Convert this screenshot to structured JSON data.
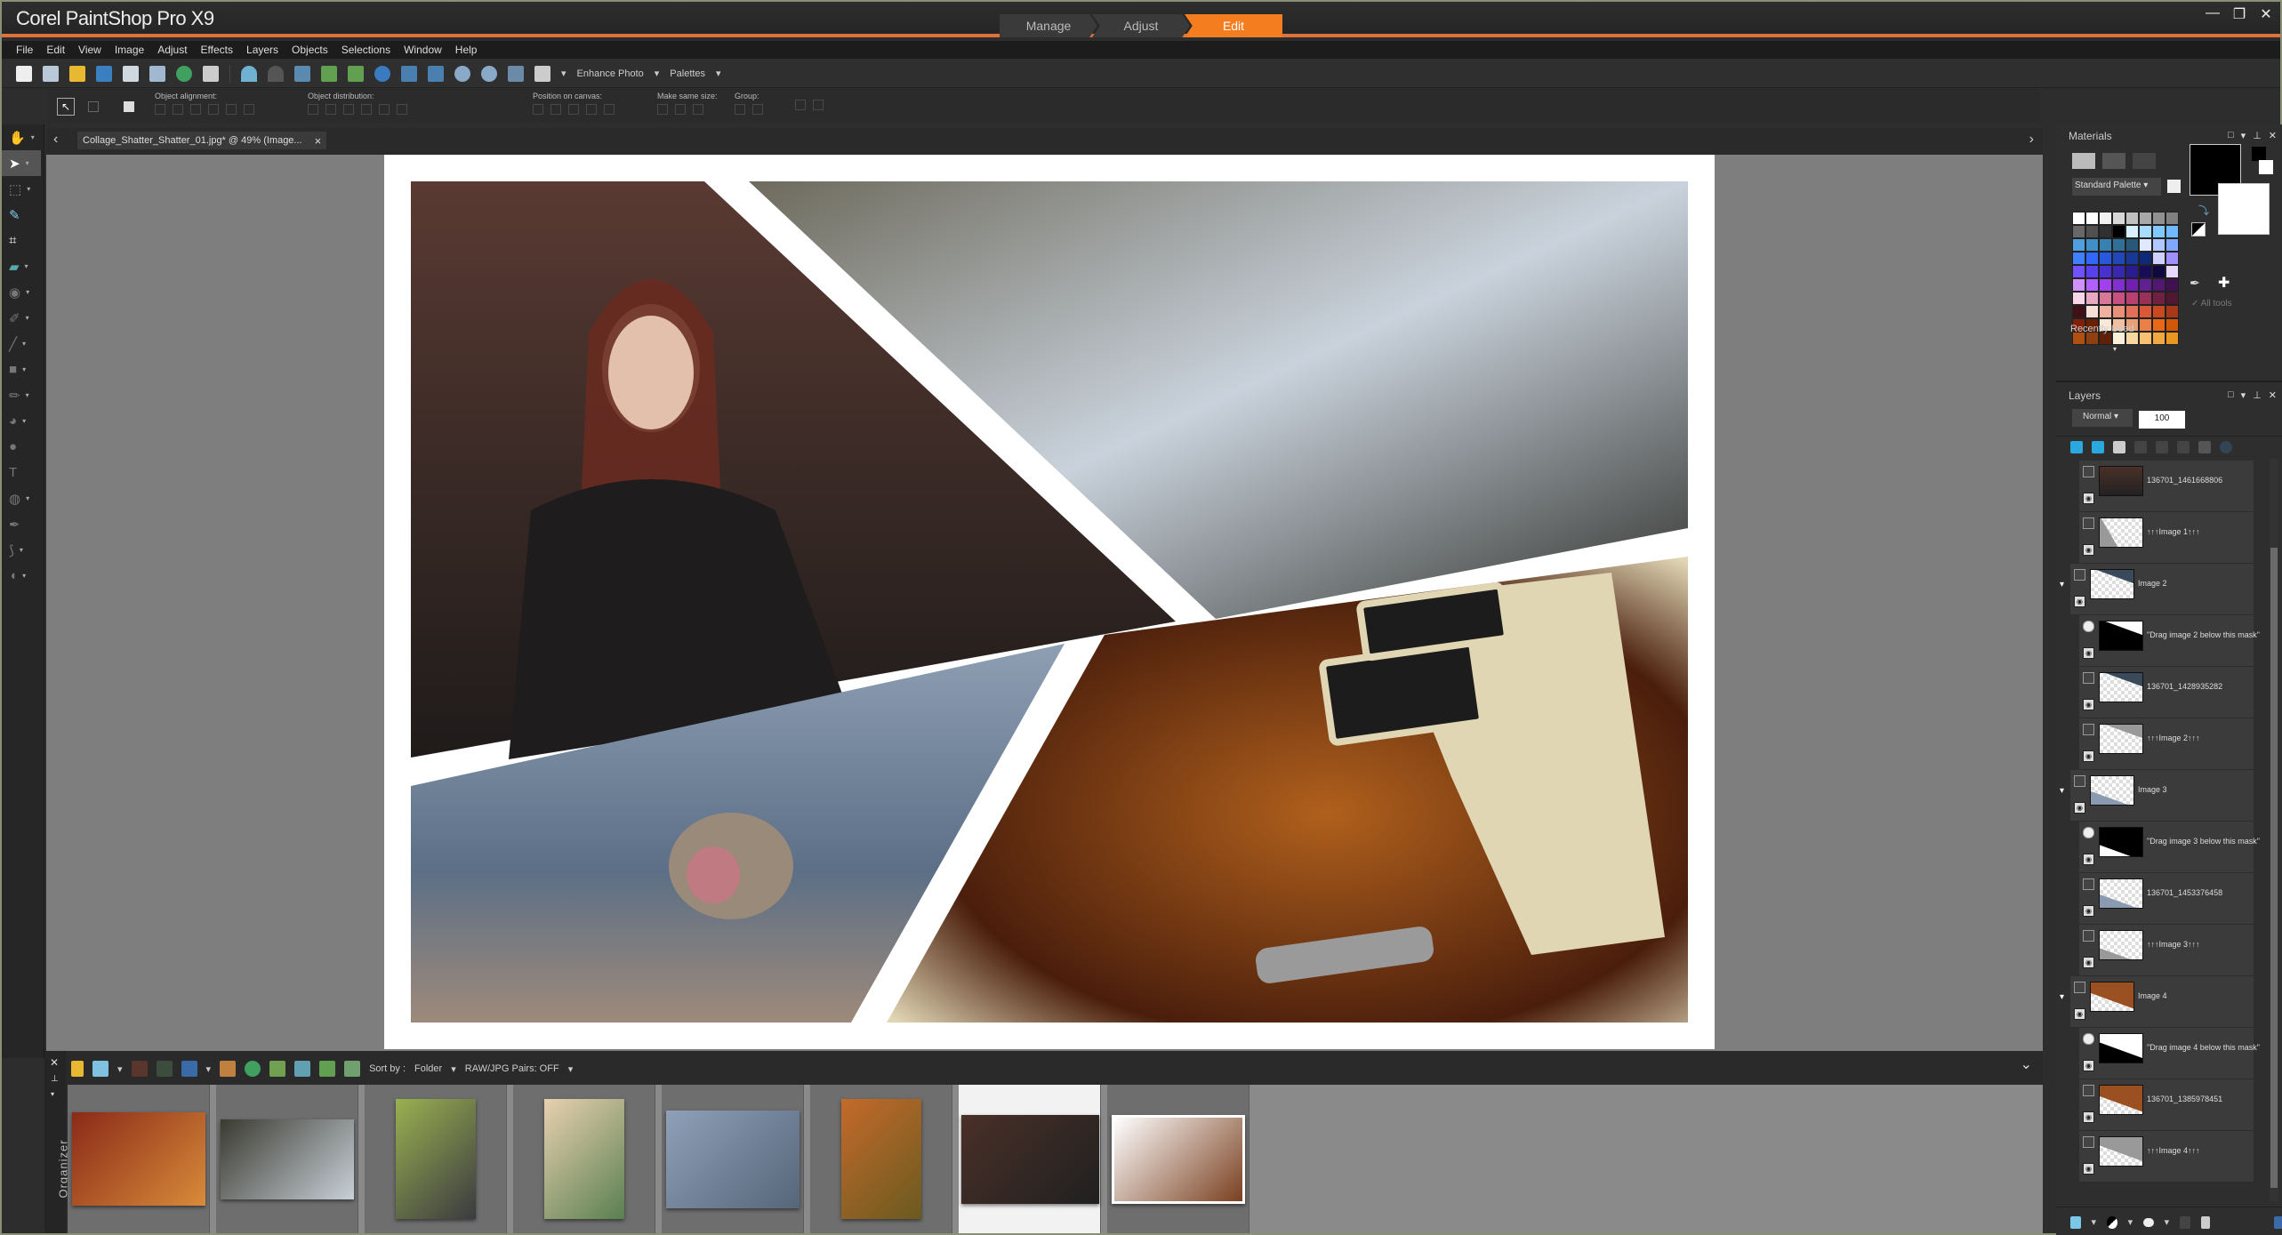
{
  "app": {
    "title": "Corel PaintShop Pro X9"
  },
  "workspace_tabs": [
    {
      "label": "Manage",
      "active": false
    },
    {
      "label": "Adjust",
      "active": false
    },
    {
      "label": "Edit",
      "active": true
    }
  ],
  "window_controls": {
    "minimize": "—",
    "restore": "❐",
    "close": "✕"
  },
  "menu": [
    "File",
    "Edit",
    "View",
    "Image",
    "Adjust",
    "Effects",
    "Layers",
    "Objects",
    "Selections",
    "Window",
    "Help"
  ],
  "toolbar": {
    "enhance_photo_label": "Enhance Photo",
    "palettes_label": "Palettes",
    "icons": [
      "new-icon",
      "new-from-template-icon",
      "open-icon",
      "scan-icon",
      "save-icon",
      "save-as-icon",
      "share-icon",
      "print-icon",
      "undo-icon",
      "redo-icon",
      "resize-icon",
      "rotate-left-icon",
      "rotate-right-icon",
      "info-icon",
      "actual-size-icon",
      "fit-window-icon",
      "zoom-out-icon",
      "zoom-in-icon",
      "zoom-settings-icon",
      "paste-icon"
    ]
  },
  "tool_options": {
    "object_alignment_label": "Object alignment:",
    "object_distribution_label": "Object distribution:",
    "position_on_canvas_label": "Position on canvas:",
    "make_same_size_label": "Make same size:",
    "group_label": "Group:"
  },
  "tools": [
    {
      "name": "pan-tool",
      "glyph": "✋",
      "selected": false,
      "has_menu": true
    },
    {
      "name": "pick-tool",
      "glyph": "➤",
      "selected": true,
      "has_menu": true
    },
    {
      "name": "selection-tool",
      "glyph": "⬚",
      "selected": false,
      "has_menu": true
    },
    {
      "name": "dropper-tool",
      "glyph": "✎",
      "selected": false,
      "has_menu": false
    },
    {
      "name": "crop-tool",
      "glyph": "⌗",
      "selected": false,
      "has_menu": false
    },
    {
      "name": "straighten-tool",
      "glyph": "▰",
      "selected": false,
      "has_menu": true
    },
    {
      "name": "red-eye-tool",
      "glyph": "◉",
      "selected": false,
      "has_menu": true
    },
    {
      "name": "makeover-tool",
      "glyph": "✐",
      "selected": false,
      "has_menu": true
    },
    {
      "name": "clone-brush-tool",
      "glyph": "╱",
      "selected": false,
      "has_menu": true
    },
    {
      "name": "background-eraser-tool",
      "glyph": "■",
      "selected": false,
      "has_menu": true
    },
    {
      "name": "paint-brush-tool",
      "glyph": "✏",
      "selected": false,
      "has_menu": true
    },
    {
      "name": "flood-fill-tool",
      "glyph": "◕",
      "selected": false,
      "has_menu": true
    },
    {
      "name": "smudge-tool",
      "glyph": "●",
      "selected": false,
      "has_menu": false
    },
    {
      "name": "text-tool",
      "glyph": "T",
      "selected": false,
      "has_menu": false
    },
    {
      "name": "preset-shape-tool",
      "glyph": "◍",
      "selected": false,
      "has_menu": true
    },
    {
      "name": "pen-tool",
      "glyph": "✒",
      "selected": false,
      "has_menu": false
    },
    {
      "name": "warp-brush-tool",
      "glyph": "⟆",
      "selected": false,
      "has_menu": true
    },
    {
      "name": "dodge-tool",
      "glyph": "◖",
      "selected": false,
      "has_menu": true
    }
  ],
  "document": {
    "tab_label": "Collage_Shatter_Shatter_01.jpg* @  49% (Image...",
    "close": "×",
    "nav_prev": "‹",
    "nav_next": "›"
  },
  "collage": {
    "photos": [
      {
        "name": "photo-woman-leather-jacket",
        "colors": [
          "#5a3a32",
          "#3a2a26",
          "#1f1b1a"
        ]
      },
      {
        "name": "photo-waterfall-stones",
        "colors": [
          "#6d6a5c",
          "#c9d2dc",
          "#2f302b"
        ]
      },
      {
        "name": "photo-snow-monkey",
        "colors": [
          "#8e9fb4",
          "#5c6f86",
          "#9d8a7a"
        ]
      },
      {
        "name": "photo-guitar",
        "colors": [
          "#b0601c",
          "#4a1e0c",
          "#e0d6b4"
        ]
      }
    ]
  },
  "organizer": {
    "label": "Organizer",
    "sort_by_label": "Sort by :",
    "sort_value": "Folder",
    "raw_jpg_label": "RAW/JPG Pairs: OFF",
    "collapse": "⌄",
    "thumbnails": [
      {
        "name": "thumb-guitar",
        "selected": false,
        "colors": [
          "#8a2a18",
          "#d98b3a"
        ]
      },
      {
        "name": "thumb-waterfall",
        "selected": false,
        "colors": [
          "#3a3a30",
          "#c8d0d8"
        ]
      },
      {
        "name": "thumb-woman-forest",
        "selected": false,
        "colors": [
          "#9ab050",
          "#3a3a40"
        ]
      },
      {
        "name": "thumb-blonde-portrait",
        "selected": false,
        "colors": [
          "#e8d0b0",
          "#5a8050"
        ]
      },
      {
        "name": "thumb-snow-monkey",
        "selected": false,
        "colors": [
          "#8fa0b8",
          "#55667a"
        ]
      },
      {
        "name": "thumb-redhead-portrait",
        "selected": false,
        "colors": [
          "#c46a2a",
          "#6a5a20"
        ]
      },
      {
        "name": "thumb-woman-alley",
        "selected": true,
        "colors": [
          "#4a3028",
          "#202020"
        ]
      },
      {
        "name": "thumb-collage",
        "selected": false,
        "colors": [
          "#ffffff",
          "#7a4020"
        ]
      }
    ]
  },
  "materials": {
    "title": "Materials",
    "palette_select": "Standard Palette",
    "recently_used": "Recently Used",
    "all_tools_label": "All tools",
    "foreground": "#000000",
    "background": "#ffffff",
    "swatches": [
      "#ffffff",
      "#ffffff",
      "#f0f0f0",
      "#d8d8d8",
      "#c0c0c0",
      "#a8a8a8",
      "#909090",
      "#808080",
      "#686868",
      "#505050",
      "#303030",
      "#000000",
      "#d8f0ff",
      "#a8dcff",
      "#80c8ff",
      "#70b8ff",
      "#50a0e0",
      "#4090c8",
      "#3880b0",
      "#307098",
      "#285878",
      "#e0e8ff",
      "#b0c8ff",
      "#80a8ff",
      "#4080ff",
      "#3068ff",
      "#2858e0",
      "#2048b8",
      "#183898",
      "#102878",
      "#d0d0ff",
      "#a090ff",
      "#7050ff",
      "#5840f0",
      "#4830d0",
      "#3828b0",
      "#281c90",
      "#180c58",
      "#100840",
      "#e8d8ff",
      "#d090ff",
      "#b060ff",
      "#a040f0",
      "#8030d0",
      "#7020b0",
      "#602090",
      "#501870",
      "#401050",
      "#f8d8e8",
      "#e8a8c0",
      "#d87898",
      "#c85080",
      "#b84070",
      "#983058",
      "#702040",
      "#501830",
      "#401018",
      "#f8e0d8",
      "#f0b0a0",
      "#e89078",
      "#e07058",
      "#d85838",
      "#c84820",
      "#a83818",
      "#802008",
      "#682000",
      "#f8e8d8",
      "#f0c0a0",
      "#e8a078",
      "#e88048",
      "#e86818",
      "#d05808",
      "#b05010",
      "#904010",
      "#602008",
      "#f8f0d8",
      "#f8d8a0",
      "#f8c070",
      "#f0a840",
      "#e89820"
    ],
    "panel_controls": [
      "□",
      "▾",
      "⊥",
      "✕"
    ]
  },
  "layers": {
    "title": "Layers",
    "blend_mode": "Normal",
    "opacity": "100",
    "panel_controls": [
      "□",
      "▾",
      "⊥",
      "✕"
    ],
    "items": [
      {
        "name": "136701_1461668806",
        "kind": "raster",
        "indent": 1,
        "thumb": "woman"
      },
      {
        "name": "↑↑↑Image 1↑↑↑",
        "kind": "raster",
        "indent": 1,
        "thumb": "grey-shape-1"
      },
      {
        "name": "Image 2",
        "kind": "group",
        "indent": 0,
        "thumb": "waterfall-partial"
      },
      {
        "name": "\"Drag image 2 below this mask\"",
        "kind": "mask",
        "indent": 1,
        "thumb": "mask-2"
      },
      {
        "name": "136701_1428935282",
        "kind": "raster",
        "indent": 1,
        "thumb": "waterfall-partial"
      },
      {
        "name": "↑↑↑Image 2↑↑↑",
        "kind": "raster",
        "indent": 1,
        "thumb": "grey-shape-2"
      },
      {
        "name": "Image 3",
        "kind": "group",
        "indent": 0,
        "thumb": "monkey-partial"
      },
      {
        "name": "\"Drag image 3 below this mask\"",
        "kind": "mask",
        "indent": 1,
        "thumb": "mask-3"
      },
      {
        "name": "136701_1453376458",
        "kind": "raster",
        "indent": 1,
        "thumb": "monkey-partial"
      },
      {
        "name": "↑↑↑Image 3↑↑↑",
        "kind": "raster",
        "indent": 1,
        "thumb": "grey-shape-3"
      },
      {
        "name": "Image 4",
        "kind": "group",
        "indent": 0,
        "thumb": "guitar-partial"
      },
      {
        "name": "\"Drag image 4 below this mask\"",
        "kind": "mask",
        "indent": 1,
        "thumb": "mask-4"
      },
      {
        "name": "136701_1385978451",
        "kind": "raster",
        "indent": 1,
        "thumb": "guitar-partial"
      },
      {
        "name": "↑↑↑Image 4↑↑↑",
        "kind": "raster",
        "indent": 1,
        "thumb": "grey-shape-4"
      }
    ]
  },
  "colors": {
    "accent": "#f47d20",
    "title_underline": "#e0713a"
  }
}
